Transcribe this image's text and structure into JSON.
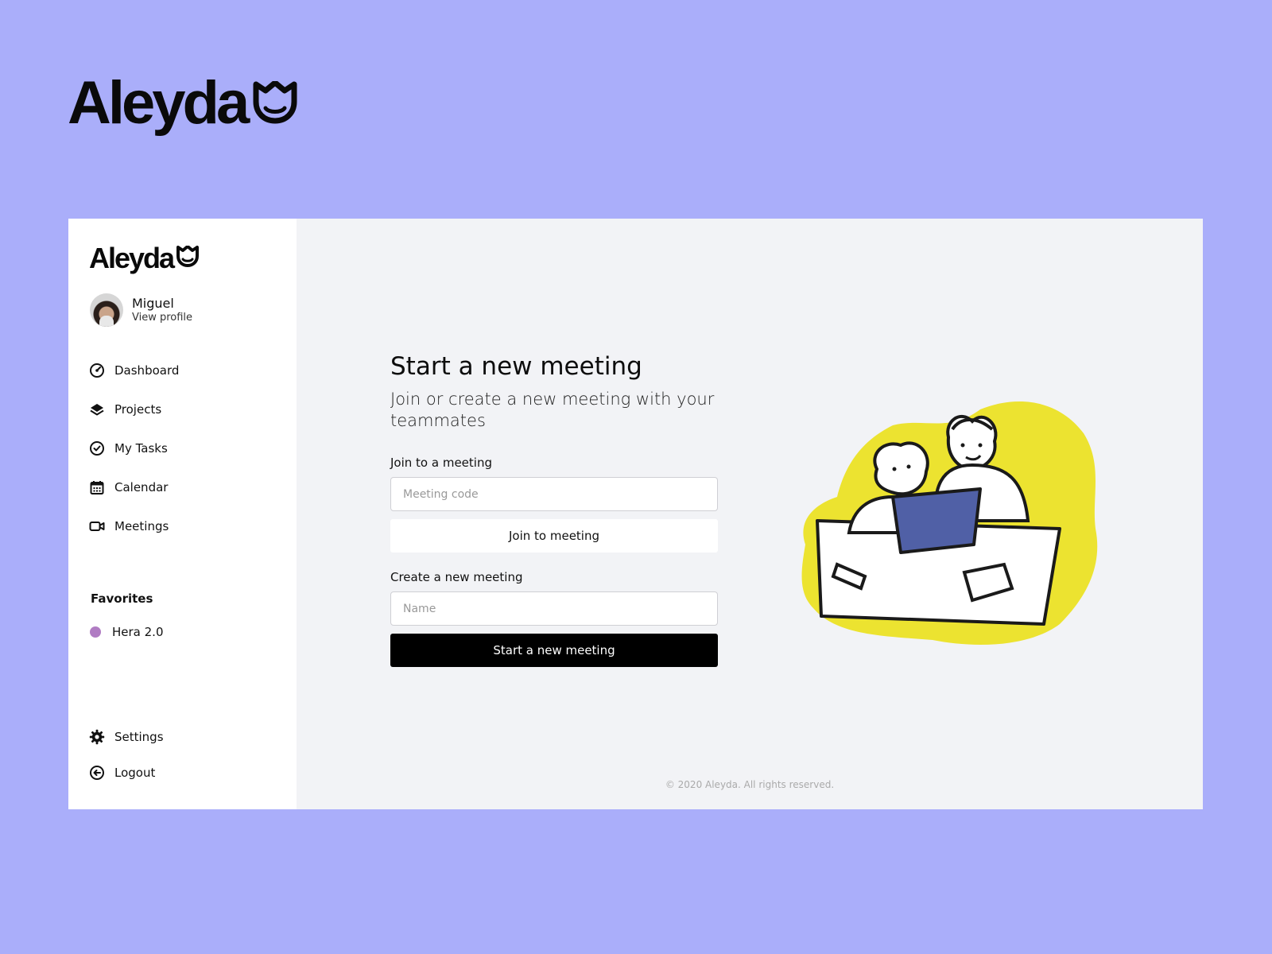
{
  "brand": {
    "name": "Aleyda"
  },
  "sidebar": {
    "user": {
      "name": "Miguel",
      "link": "View profile"
    },
    "nav": [
      {
        "label": "Dashboard",
        "icon": "dashboard-icon"
      },
      {
        "label": "Projects",
        "icon": "layers-icon"
      },
      {
        "label": "My Tasks",
        "icon": "check-circle-icon"
      },
      {
        "label": "Calendar",
        "icon": "calendar-icon"
      },
      {
        "label": "Meetings",
        "icon": "video-icon"
      }
    ],
    "favorites_title": "Favorites",
    "favorites": [
      {
        "label": "Hera 2.0",
        "color": "#b07cc3"
      }
    ],
    "bottom": [
      {
        "label": "Settings",
        "icon": "gear-icon"
      },
      {
        "label": "Logout",
        "icon": "logout-icon"
      }
    ]
  },
  "main": {
    "title": "Start a new meeting",
    "subtitle": "Join or create a new meeting with your teammates",
    "join": {
      "label": "Join to a meeting",
      "placeholder": "Meeting code",
      "button": "Join to meeting"
    },
    "create": {
      "label": "Create a new meeting",
      "placeholder": "Name",
      "button": "Start a new meeting"
    },
    "footer": "© 2020 Aleyda. All rights reserved."
  },
  "colors": {
    "background": "#aaaefa",
    "accent_yellow": "#ece330",
    "tablet_blue": "#5060a6"
  }
}
